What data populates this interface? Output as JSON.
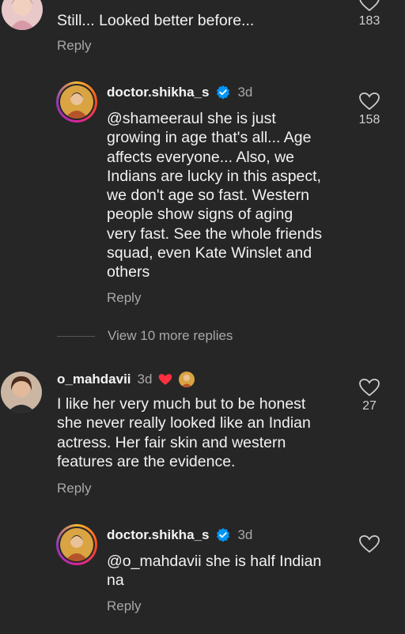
{
  "comments": [
    {
      "id": "c0",
      "text": "Still... Looked better before...",
      "reply_label": "Reply",
      "like_count": "183"
    },
    {
      "id": "c1",
      "username": "doctor.shikha_s",
      "time": "3d",
      "text": "@shameeraul she is just\ngrowing in age that's all... Age\naffects everyone... Also, we\nIndians are lucky in this aspect,\nwe don't age so fast. Western\npeople show signs of aging\nvery fast. See the whole friends\nsquad, even Kate Winslet and\nothers",
      "reply_label": "Reply",
      "like_count": "158"
    },
    {
      "id": "c2",
      "username": "o_mahdavii",
      "time": "3d",
      "text": "I like her very much but to be honest\nshe never really looked like an Indian\nactress. Her fair skin and western\nfeatures are the evidence.",
      "reply_label": "Reply",
      "like_count": "27"
    },
    {
      "id": "c3",
      "username": "doctor.shikha_s",
      "time": "3d",
      "text": "@o_mahdavii she is half Indian\nna",
      "reply_label": "Reply"
    }
  ],
  "view_more": "View 10 more replies",
  "icons": {
    "heart": "heart-outline-icon",
    "verified": "verified-badge-icon",
    "red_heart": "red-heart-icon"
  },
  "colors": {
    "background": "#262626",
    "verified_blue": "#0095f6",
    "secondary_text": "#a8a8a8"
  }
}
